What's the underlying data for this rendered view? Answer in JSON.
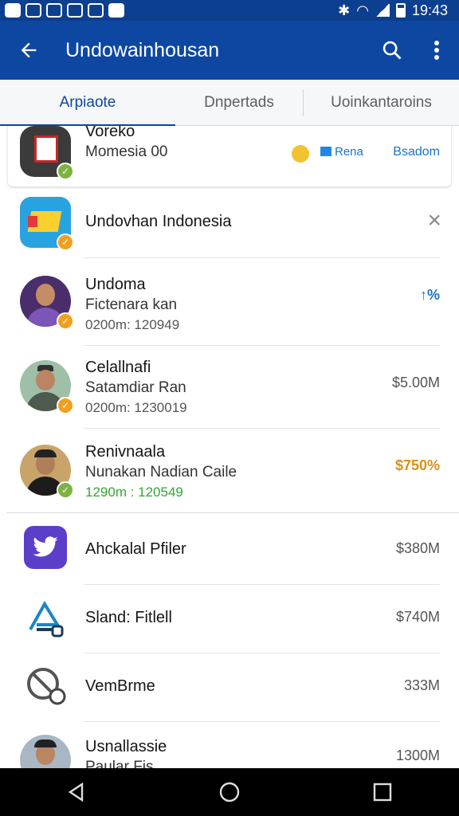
{
  "status_bar": {
    "time": "19:43"
  },
  "app_bar": {
    "title": "Undowainhousan",
    "back_icon": "arrow-left-icon",
    "search_icon": "search-icon",
    "more_icon": "more-vert-icon"
  },
  "tabs": [
    {
      "label": "Arpiaote",
      "active": true
    },
    {
      "label": "Dnpertads",
      "active": false
    },
    {
      "label": "Uoinkantaroins",
      "active": false
    }
  ],
  "list": [
    {
      "title": "Voreko",
      "subtitle": "Momesia 00",
      "chip1": "Rena",
      "chip2": "Bsadom"
    },
    {
      "title": "Undovhan Indonesia",
      "action": "×"
    },
    {
      "title": "Undoma",
      "subtitle": "Fictenara kan",
      "meta": "0200m: 120949",
      "value": "↑%"
    },
    {
      "title": "Celallnafi",
      "subtitle": "Satamdiar Ran",
      "meta": "0200m: 1230019",
      "value": "$5.00M"
    },
    {
      "title": "Renivnaala",
      "subtitle": "Nunakan Nadian Caile",
      "meta": "1290m : 120549",
      "value": "$750%"
    },
    {
      "title": "Ahckalal Pfiler",
      "value": "$380M"
    },
    {
      "title": "Sland: Fitlell",
      "value": "$740M"
    },
    {
      "title": "VemBrme",
      "value": "333M"
    },
    {
      "title": "Usnallassie",
      "subtitle": "Paular Fis",
      "value": "1300M"
    }
  ],
  "colors": {
    "primary": "#0d47a1",
    "accent_orange": "#d7901a",
    "accent_green": "#34a534"
  }
}
